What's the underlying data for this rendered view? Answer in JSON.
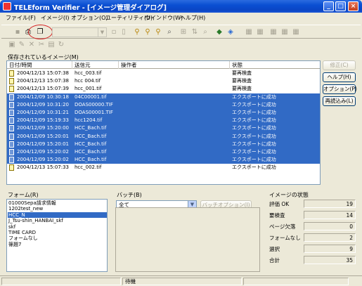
{
  "window": {
    "title": "TELEform Verifier - [イメージ管理ダイアログ]",
    "minimize": "_",
    "maximize": "□",
    "close": "×"
  },
  "menu": [
    "ファイル(F)",
    "イメージ(I)",
    "オプション(O)",
    "ユーティリティ(U)",
    "ウインドウ(W)",
    "ヘルプ(H)"
  ],
  "toolbar": {
    "icons": [
      "save-icon",
      "print-icon",
      "copy-doc-icon",
      "blank-doc-icon",
      "doc-icon",
      "find-icon",
      "find-replace-icon",
      "find-next-icon",
      "zoom-icon",
      "grid-icon",
      "sort-icon",
      "search-doc-icon",
      "batch-icon",
      "export-icon"
    ],
    "toolbar2_icons": [
      "image-icon",
      "edit-icon",
      "delete-icon",
      "cut-icon",
      "paste-icon",
      "refresh-icon"
    ]
  },
  "saved_images": {
    "label": "保存されているイメージ(M)",
    "columns": [
      "日付/時間",
      "送信元",
      "操作者",
      "状態"
    ],
    "rows": [
      {
        "datetime": "2004/12/13 15:07:38",
        "source": "hcc_003.tif",
        "operator": "",
        "status": "要再検査",
        "selected": false
      },
      {
        "datetime": "2004/12/13 15:07:38",
        "source": "hcc 004.tif",
        "operator": "",
        "status": "要再検査",
        "selected": false
      },
      {
        "datetime": "2004/12/13 15:07:39",
        "source": "hcc_001.tif",
        "operator": "",
        "status": "要再検査",
        "selected": false
      },
      {
        "datetime": "2004/12/09 10:30:18",
        "source": "04C00001.tif",
        "operator": "",
        "status": "エクスポートに成功",
        "selected": true
      },
      {
        "datetime": "2004/12/09 10:31:20",
        "source": "DOAS00000.TIF",
        "operator": "",
        "status": "エクスポートに成功",
        "selected": true
      },
      {
        "datetime": "2004/12/09 10:31:21",
        "source": "DOAS00001.TIF",
        "operator": "",
        "status": "エクスポートに成功",
        "selected": true
      },
      {
        "datetime": "2004/12/09 15:19:33",
        "source": "hcc1204.tif",
        "operator": "",
        "status": "エクスポートに成功",
        "selected": true
      },
      {
        "datetime": "2004/12/09 15:20:00",
        "source": "HCC_Bach.tif",
        "operator": "",
        "status": "エクスポートに成功",
        "selected": true
      },
      {
        "datetime": "2004/12/09 15:20:01",
        "source": "HCC_Bach.tif",
        "operator": "",
        "status": "エクスポートに成功",
        "selected": true
      },
      {
        "datetime": "2004/12/09 15:20:01",
        "source": "HCC_Bach.tif",
        "operator": "",
        "status": "エクスポートに成功",
        "selected": true
      },
      {
        "datetime": "2004/12/09 15:20:02",
        "source": "HCC_Bach.tif",
        "operator": "",
        "status": "エクスポートに成功",
        "selected": true
      },
      {
        "datetime": "2004/12/09 15:20:02",
        "source": "HCC_Bach.tif",
        "operator": "",
        "status": "エクスポートに成功",
        "selected": true
      },
      {
        "datetime": "2004/12/13 15:07:33",
        "source": "hcc_002.tif",
        "operator": "",
        "status": "エクスポートに成功",
        "selected": false
      }
    ]
  },
  "buttons": {
    "fix": "修正(C)",
    "help": "ヘルプ(H)",
    "options": "オプション(P)",
    "reload": "再読込み(L)"
  },
  "forms": {
    "label": "フォーム(R)",
    "items": [
      {
        "name": "01000Sepa請求情報",
        "selected": false
      },
      {
        "name": "1202test_new",
        "selected": false
      },
      {
        "name": "HCC_N",
        "selected": true
      },
      {
        "name": "J_Tsu-shin_HANBAI_skf",
        "selected": false
      },
      {
        "name": "skf",
        "selected": false
      },
      {
        "name": "TIME CARD",
        "selected": false
      },
      {
        "name": "フォームなし",
        "selected": false
      },
      {
        "name": "篠題7",
        "selected": false
      }
    ]
  },
  "batch": {
    "label": "バッチ(B)",
    "selected": "全て",
    "options_button": "バッチオプション(I)"
  },
  "image_status": {
    "label": "イメージの状態",
    "items": [
      {
        "label": "評価 OK",
        "value": "19"
      },
      {
        "label": "要検査",
        "value": "14"
      },
      {
        "label": "ページ欠落",
        "value": "0"
      },
      {
        "label": "フォームなし",
        "value": "2"
      },
      {
        "label": "選択",
        "value": "9"
      },
      {
        "label": "合計",
        "value": "35"
      }
    ]
  },
  "statusbar": {
    "text": "待機"
  }
}
